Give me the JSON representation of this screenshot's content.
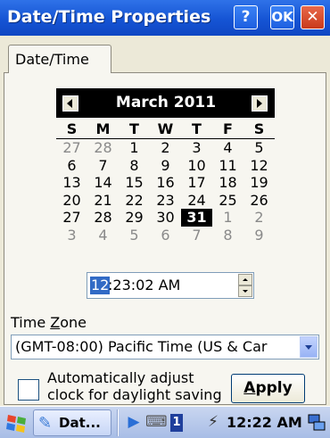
{
  "window": {
    "title": "Date/Time Properties",
    "help_label": "?",
    "ok_label": "OK",
    "close_label": "✕"
  },
  "tab": {
    "label": "Date/Time"
  },
  "calendar": {
    "month_label": "March 2011",
    "weekdays": [
      "S",
      "M",
      "T",
      "W",
      "T",
      "F",
      "S"
    ],
    "weeks": [
      [
        {
          "d": "27",
          "dim": true
        },
        {
          "d": "28",
          "dim": true
        },
        {
          "d": "1"
        },
        {
          "d": "2"
        },
        {
          "d": "3"
        },
        {
          "d": "4"
        },
        {
          "d": "5"
        }
      ],
      [
        {
          "d": "6"
        },
        {
          "d": "7"
        },
        {
          "d": "8"
        },
        {
          "d": "9"
        },
        {
          "d": "10"
        },
        {
          "d": "11"
        },
        {
          "d": "12"
        }
      ],
      [
        {
          "d": "13"
        },
        {
          "d": "14"
        },
        {
          "d": "15"
        },
        {
          "d": "16"
        },
        {
          "d": "17"
        },
        {
          "d": "18"
        },
        {
          "d": "19"
        }
      ],
      [
        {
          "d": "20"
        },
        {
          "d": "21"
        },
        {
          "d": "22"
        },
        {
          "d": "23"
        },
        {
          "d": "24"
        },
        {
          "d": "25"
        },
        {
          "d": "26"
        }
      ],
      [
        {
          "d": "27"
        },
        {
          "d": "28"
        },
        {
          "d": "29"
        },
        {
          "d": "30"
        },
        {
          "d": "31",
          "selected": true
        },
        {
          "d": "1",
          "dim": true
        },
        {
          "d": "2",
          "dim": true
        }
      ],
      [
        {
          "d": "3",
          "dim": true
        },
        {
          "d": "4",
          "dim": true
        },
        {
          "d": "5",
          "dim": true
        },
        {
          "d": "6",
          "dim": true
        },
        {
          "d": "7",
          "dim": true
        },
        {
          "d": "8",
          "dim": true
        },
        {
          "d": "9",
          "dim": true
        }
      ]
    ]
  },
  "time": {
    "hour": "12",
    "rest": ":23:02 AM"
  },
  "timezone": {
    "label": "Time Zone",
    "value": "(GMT-08:00) Pacific Time (US & Car"
  },
  "daylight": {
    "checked": false,
    "label_line1": "Automatically adjust",
    "label_line2": "clock for daylight saving"
  },
  "apply_label": "Apply",
  "taskbar": {
    "task_label": "Dat...",
    "tray_lang": "1",
    "clock": "12:22 AM"
  },
  "colors": {
    "titlebar": "#1554d4",
    "selection": "#316ac5",
    "calendar_header": "#000000"
  }
}
